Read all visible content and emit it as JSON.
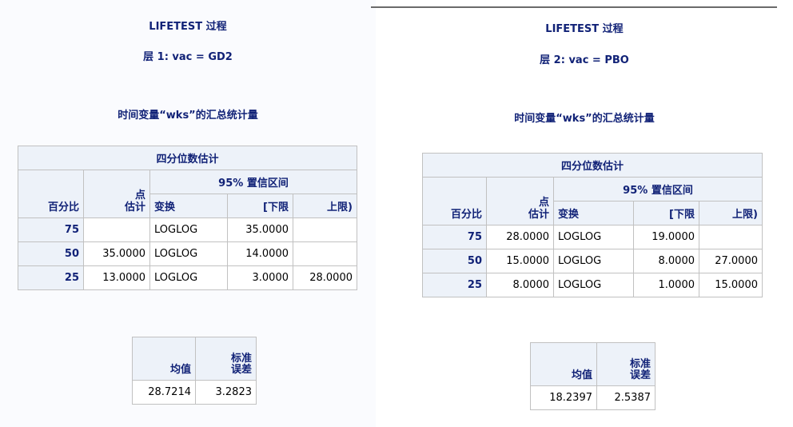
{
  "left": {
    "title": "LIFETEST 过程",
    "stratum": "层 1: vac = GD2",
    "heading": "时间变量“wks”的汇总统计量",
    "quartile_table": {
      "caption": "四分位数估计",
      "ci_header": "95% 置信区间",
      "col_percent": "百分比",
      "col_point_1": "点",
      "col_point_2": "估计",
      "col_transform": "变换",
      "col_lower": "[下限",
      "col_upper": "上限)",
      "rows": [
        {
          "pct": "75",
          "est": "",
          "transform": "LOGLOG",
          "lower": "35.0000",
          "upper": ""
        },
        {
          "pct": "50",
          "est": "35.0000",
          "transform": "LOGLOG",
          "lower": "14.0000",
          "upper": ""
        },
        {
          "pct": "25",
          "est": "13.0000",
          "transform": "LOGLOG",
          "lower": "3.0000",
          "upper": "28.0000"
        }
      ]
    },
    "mean_table": {
      "col_mean": "均值",
      "col_se_1": "标准",
      "col_se_2": "误差",
      "mean": "28.7214",
      "se": "3.2823"
    }
  },
  "right": {
    "title": "LIFETEST 过程",
    "stratum": "层 2: vac = PBO",
    "heading": "时间变量“wks”的汇总统计量",
    "quartile_table": {
      "caption": "四分位数估计",
      "ci_header": "95% 置信区间",
      "col_percent": "百分比",
      "col_point_1": "点",
      "col_point_2": "估计",
      "col_transform": "变换",
      "col_lower": "[下限",
      "col_upper": "上限)",
      "rows": [
        {
          "pct": "75",
          "est": "28.0000",
          "transform": "LOGLOG",
          "lower": "19.0000",
          "upper": ""
        },
        {
          "pct": "50",
          "est": "15.0000",
          "transform": "LOGLOG",
          "lower": "8.0000",
          "upper": "27.0000"
        },
        {
          "pct": "25",
          "est": "8.0000",
          "transform": "LOGLOG",
          "lower": "1.0000",
          "upper": "15.0000"
        }
      ]
    },
    "mean_table": {
      "col_mean": "均值",
      "col_se_1": "标准",
      "col_se_2": "误差",
      "mean": "18.2397",
      "se": "2.5387"
    }
  }
}
